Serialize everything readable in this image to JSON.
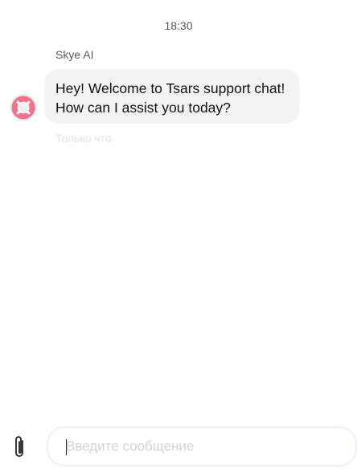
{
  "chat": {
    "timestamp": "18:30",
    "sender_name": "Skye AI",
    "message_text": "Hey! Welcome to Tsars support chat!\nHow can I assist you today?",
    "message_status": "Только что",
    "avatar_icon": "lifebuoy-icon",
    "avatar_colors": {
      "ring": "#f2728a",
      "stripe": "#ffffff"
    }
  },
  "composer": {
    "attach_icon": "paperclip-icon",
    "input_value": "",
    "input_placeholder": "Введите сообщение"
  }
}
